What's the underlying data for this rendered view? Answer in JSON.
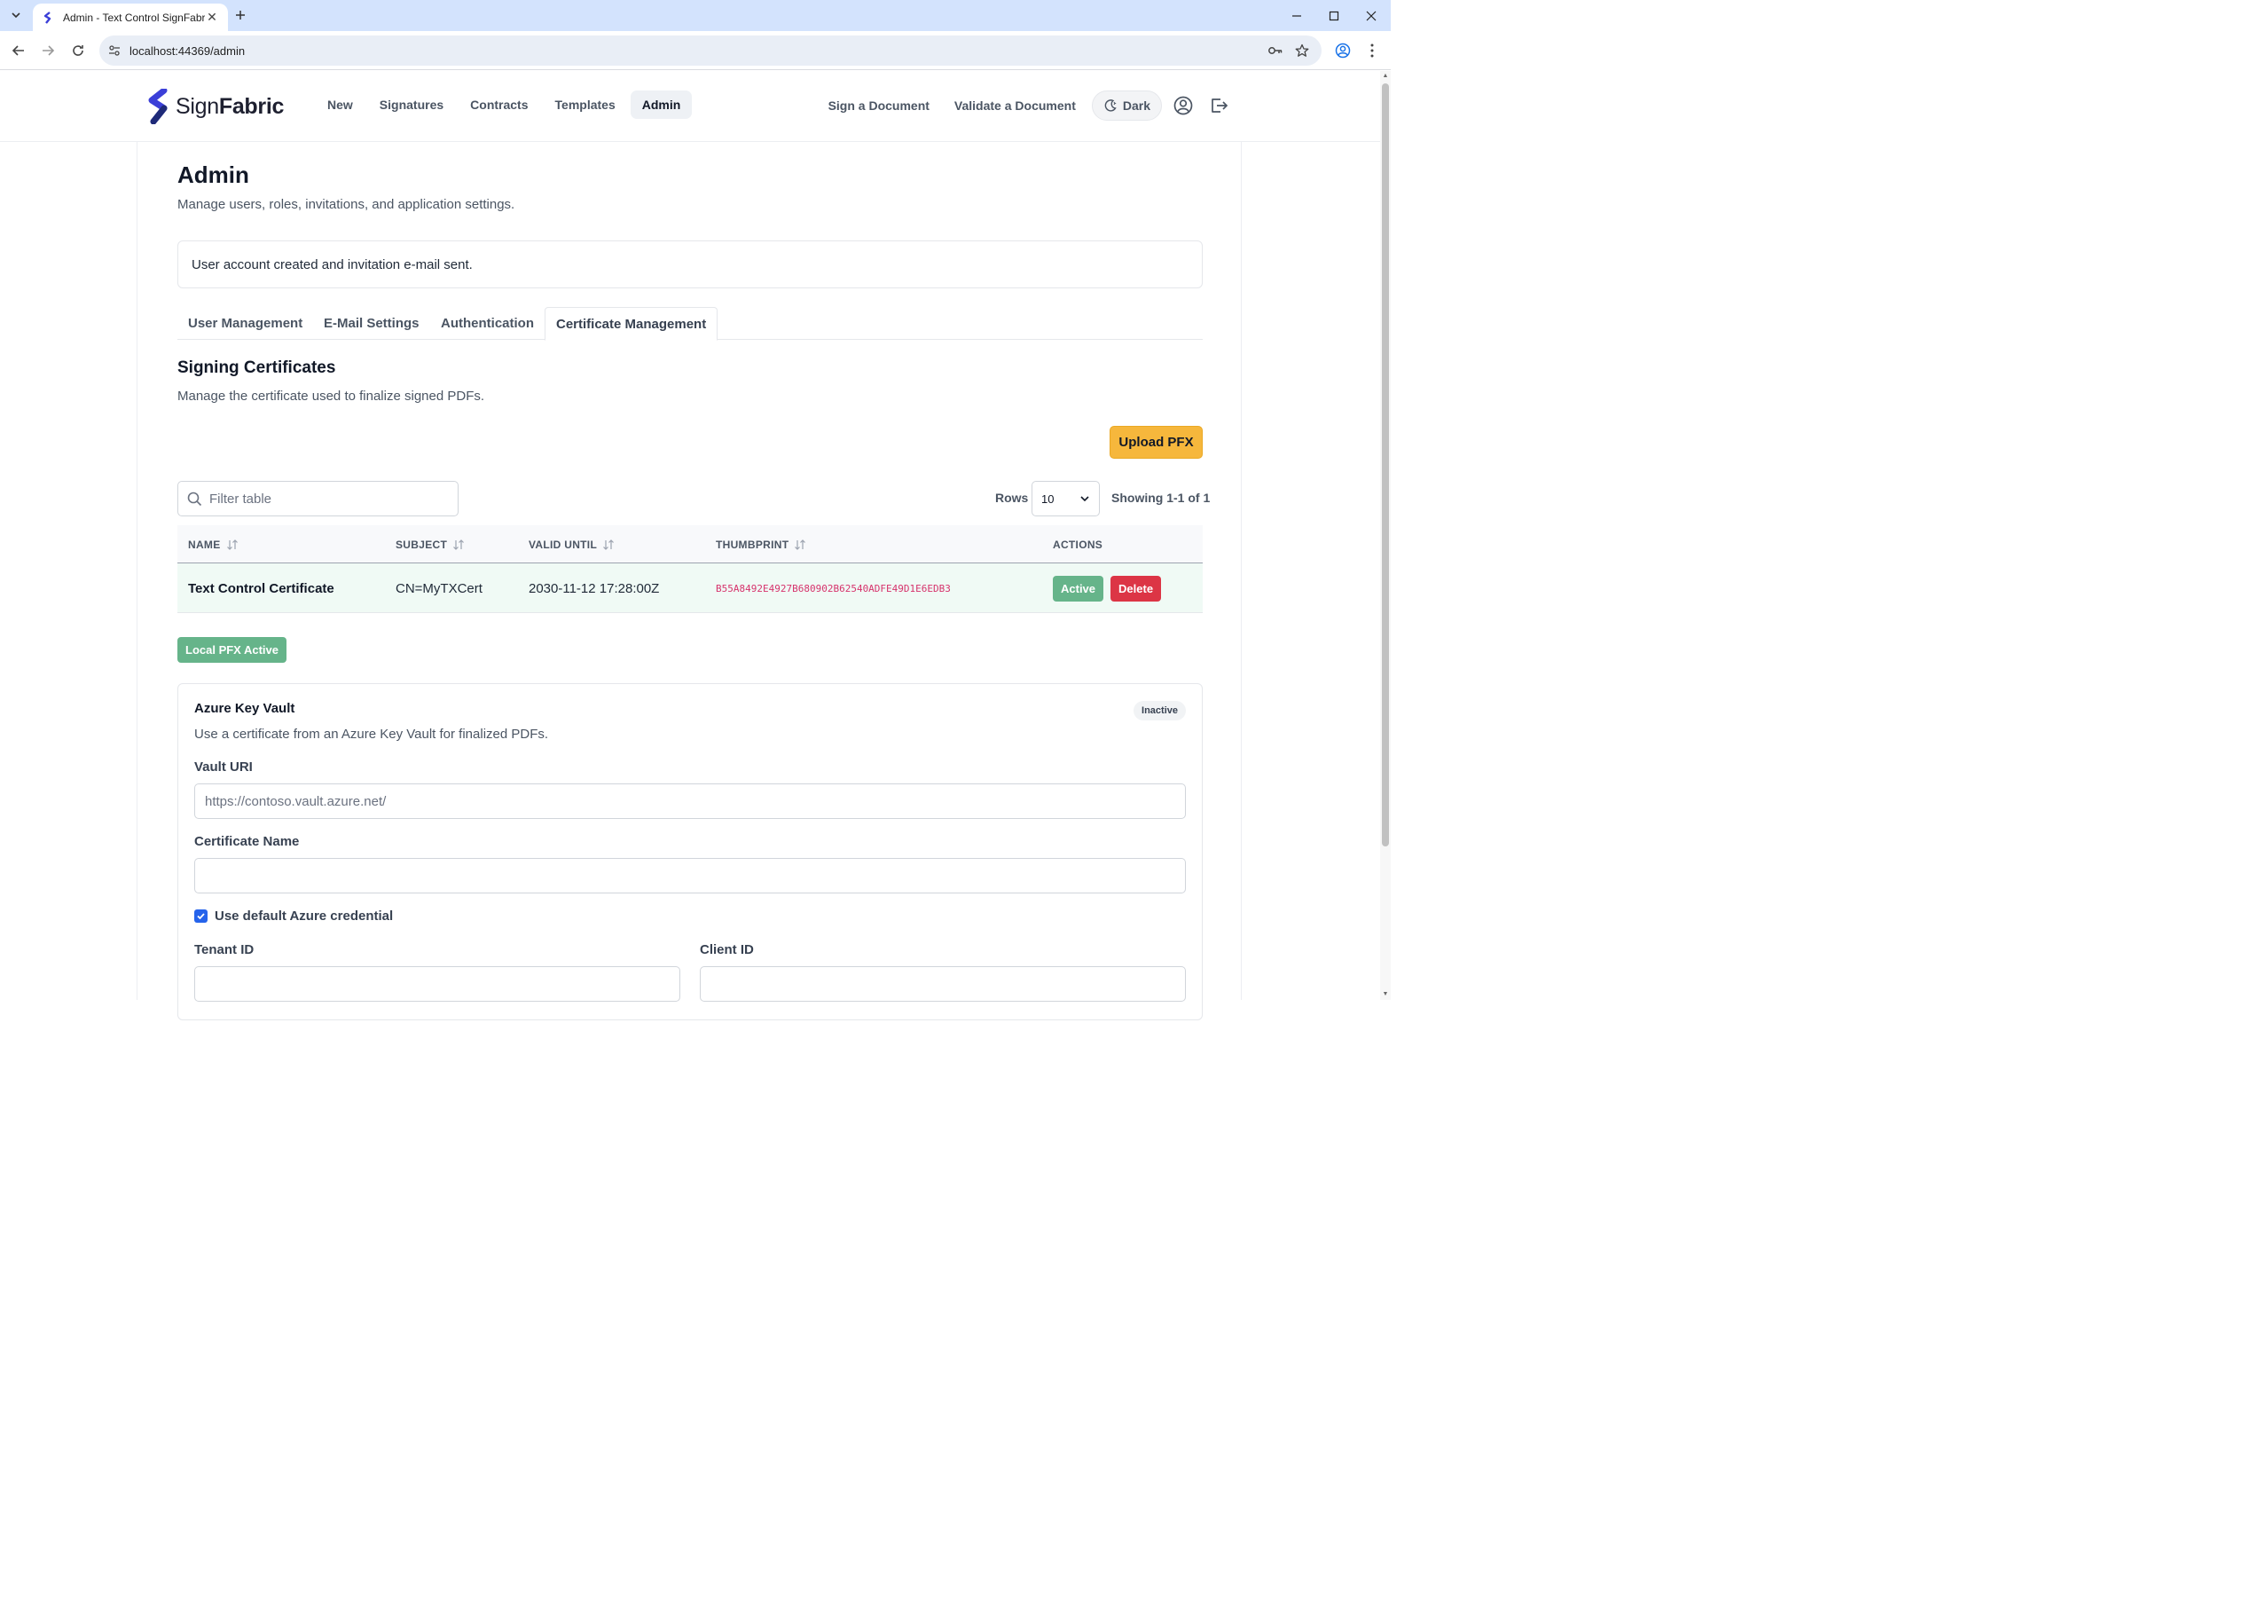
{
  "browser": {
    "tab_title": "Admin - Text Control SignFabric",
    "url": "localhost:44369/admin"
  },
  "header": {
    "logo_light": "Sign",
    "logo_bold": "Fabric",
    "nav": [
      "New",
      "Signatures",
      "Contracts",
      "Templates",
      "Admin"
    ],
    "active_nav": "Admin",
    "sign_doc": "Sign a Document",
    "validate_doc": "Validate a Document",
    "dark_label": "Dark"
  },
  "page": {
    "title": "Admin",
    "subtitle": "Manage users, roles, invitations, and application settings.",
    "alert": "User account created and invitation e-mail sent."
  },
  "tabs": [
    "User Management",
    "E-Mail Settings",
    "Authentication",
    "Certificate Management"
  ],
  "certs": {
    "title": "Signing Certificates",
    "subtitle": "Manage the certificate used to finalize signed PDFs.",
    "upload_label": "Upload PFX",
    "filter_placeholder": "Filter table",
    "rows_label": "Rows",
    "rows_value": "10",
    "showing": "Showing 1-1 of 1",
    "columns": [
      "NAME",
      "SUBJECT",
      "VALID UNTIL",
      "THUMBPRINT",
      "ACTIONS"
    ],
    "rows": [
      {
        "name": "Text Control Certificate",
        "subject": "CN=MyTXCert",
        "valid_until": "2030-11-12 17:28:00Z",
        "thumbprint": "B55A8492E4927B680902B62540ADFE49D1E6EDB3",
        "status": "Active",
        "delete": "Delete"
      }
    ],
    "local_status": "Local PFX Active"
  },
  "azure": {
    "title": "Azure Key Vault",
    "badge": "Inactive",
    "description": "Use a certificate from an Azure Key Vault for finalized PDFs.",
    "vault_uri_label": "Vault URI",
    "vault_uri_placeholder": "https://contoso.vault.azure.net/",
    "cert_name_label": "Certificate Name",
    "default_cred_label": "Use default Azure credential",
    "tenant_label": "Tenant ID",
    "client_label": "Client ID"
  },
  "colors": {
    "accent_yellow": "#f6b73c",
    "success_green": "#66b48a",
    "danger_red": "#dc3545",
    "thumbprint_pink": "#d6336c",
    "logo_blue": "#3b3fd8"
  }
}
